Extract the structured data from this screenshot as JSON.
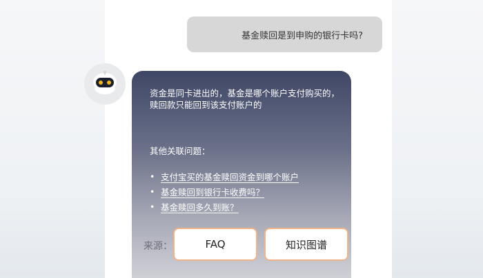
{
  "chat": {
    "user_question": "基金赎回是到申购的银行卡吗?",
    "bot": {
      "avatar_icon": "robot-icon",
      "answer_line1": "资金是同卡进出的，基金是哪个账户支付购买的，",
      "answer_line2": "赎回款只能回到该支付账户的",
      "related_title": "其他关联问题：",
      "related_bullet": "•",
      "related_questions": [
        "支付宝买的基金赎回资金到哪个账户",
        "基金赎回到银行卡收费吗？",
        "基金赎回多久到账？"
      ],
      "source_label": "来源：",
      "source_buttons": [
        "FAQ",
        "知识图谱"
      ]
    }
  },
  "colors": {
    "button_border": "#f0b38a",
    "bubble_top": "#3f4766",
    "user_bubble": "#d7d7d8"
  }
}
